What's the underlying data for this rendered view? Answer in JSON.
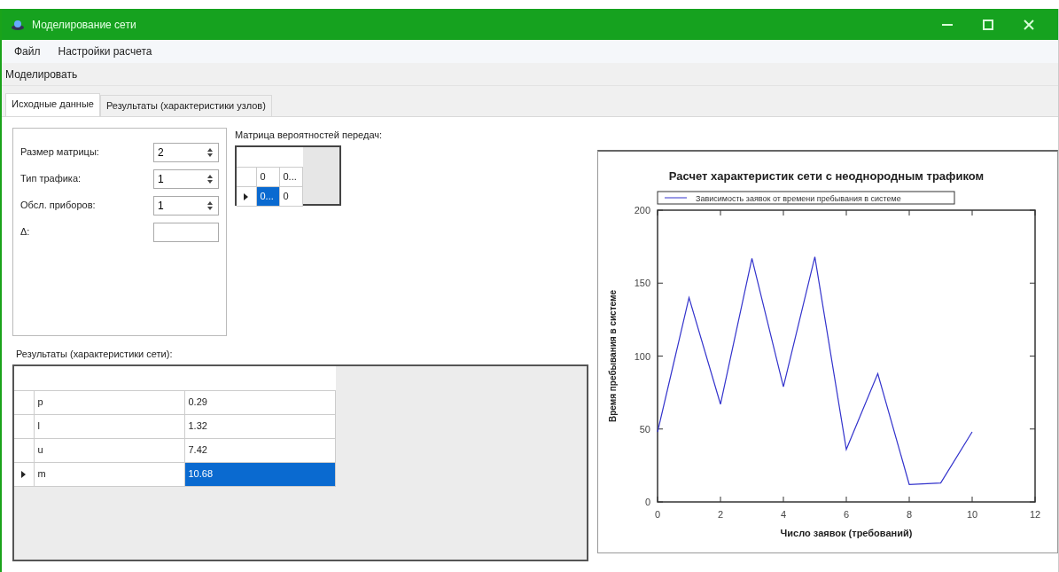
{
  "window": {
    "title": "Моделирование сети"
  },
  "menu": [
    {
      "label": "Файл"
    },
    {
      "label": "Настройки расчета"
    }
  ],
  "toolbar": [
    {
      "label": "Моделировать"
    }
  ],
  "tabs": [
    {
      "label": "Исходные данные",
      "selected": true
    },
    {
      "label": "Результаты (характеристики узлов)",
      "selected": false
    }
  ],
  "params": [
    {
      "label": "Размер матрицы:",
      "value": "2",
      "kind": "spinner"
    },
    {
      "label": "Тип трафика:",
      "value": "1",
      "kind": "spinner"
    },
    {
      "label": "Обсл. приборов:",
      "value": "1",
      "kind": "spinner"
    },
    {
      "label": "Δ:",
      "kind": "text"
    }
  ],
  "matrix": {
    "title": "Матрица вероятностей передач:",
    "rows": [
      {
        "current": false,
        "cells": [
          {
            "text": "0",
            "selected": false
          },
          {
            "text": "0...",
            "selected": false
          }
        ]
      },
      {
        "current": true,
        "cells": [
          {
            "text": "0...",
            "selected": true
          },
          {
            "text": "0",
            "selected": false
          }
        ]
      }
    ]
  },
  "results": {
    "title": "Результаты (характеристики сети):",
    "rows": [
      {
        "current": false,
        "cells": [
          {
            "text": "p",
            "selected": false
          },
          {
            "text": "0.29",
            "selected": false
          }
        ]
      },
      {
        "current": false,
        "cells": [
          {
            "text": "l",
            "selected": false
          },
          {
            "text": "1.32",
            "selected": false
          }
        ]
      },
      {
        "current": false,
        "cells": [
          {
            "text": "u",
            "selected": false
          },
          {
            "text": "7.42",
            "selected": false
          }
        ]
      },
      {
        "current": true,
        "cells": [
          {
            "text": "m",
            "selected": false
          },
          {
            "text": "10.68",
            "selected": true
          }
        ]
      }
    ]
  },
  "chart": {
    "chart_data": {
      "type": "line",
      "title": "Расчет характеристик сети с неоднородным трафиком",
      "xlabel": "Число заявок (требований)",
      "ylabel": "Время пребывания в системе",
      "x": [
        0,
        1,
        2,
        3,
        4,
        5,
        6,
        7,
        8,
        9,
        10
      ],
      "series": [
        {
          "name": "Зависимость заявок от времени пребывания в системе",
          "color": "#3333cc",
          "values": [
            48,
            140,
            67,
            167,
            79,
            168,
            36,
            88,
            12,
            13,
            48
          ]
        }
      ],
      "xlim": [
        0,
        12
      ],
      "ylim": [
        0,
        200
      ],
      "xticks": [
        0,
        2,
        4,
        6,
        8,
        10,
        12
      ],
      "yticks": [
        0,
        50,
        100,
        150,
        200
      ]
    }
  }
}
